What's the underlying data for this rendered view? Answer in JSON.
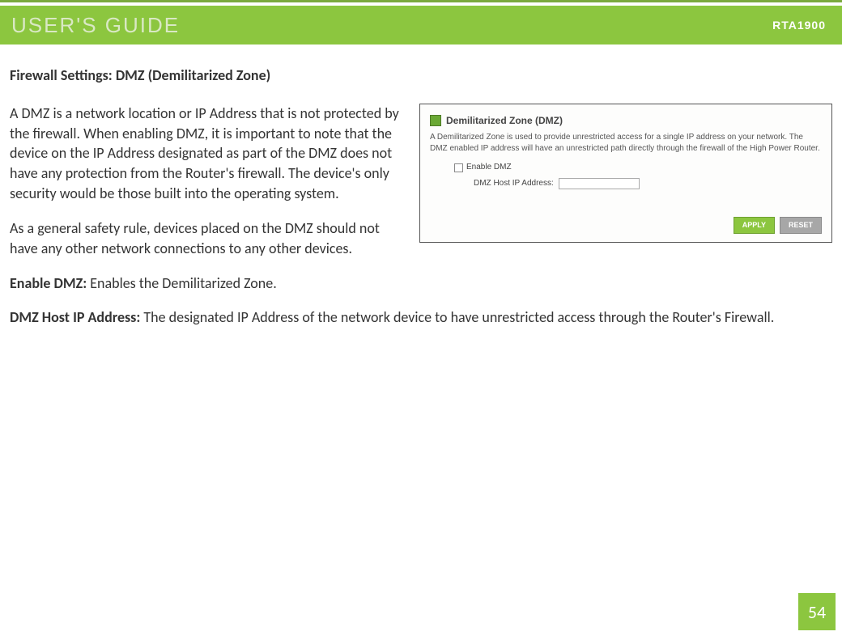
{
  "header": {
    "title": "USER'S GUIDE",
    "model": "RTA1900"
  },
  "section": {
    "heading": "Firewall Settings: DMZ (Demilitarized Zone)",
    "para1": "A DMZ is a network location or IP Address that is not protected by the firewall.  When enabling DMZ, it is important to note that the device on the IP Address designated as part of the DMZ does not have any protection from the Router's firewall.  The device's only security would be those built into the operating system.",
    "para2": "As a general safety rule, devices placed on the DMZ should not have any other network connections to any other devices."
  },
  "definitions": {
    "enable_dmz_label": "Enable DMZ:",
    "enable_dmz_text": " Enables the Demilitarized Zone.",
    "dmz_host_label": "DMZ Host IP Address:",
    "dmz_host_text": " The designated IP Address of the network device to have unrestricted access through the Router's Firewall."
  },
  "panel": {
    "title": "Demilitarized Zone (DMZ)",
    "desc": "A Demilitarized Zone is used to provide unrestricted access for a single IP address on your network. The DMZ enabled IP address will have an unrestricted path directly through the firewall of the High Power Router.",
    "enable_label": "Enable DMZ",
    "ip_label": "DMZ Host IP Address:",
    "apply": "APPLY",
    "reset": "RESET"
  },
  "page_number": "54"
}
